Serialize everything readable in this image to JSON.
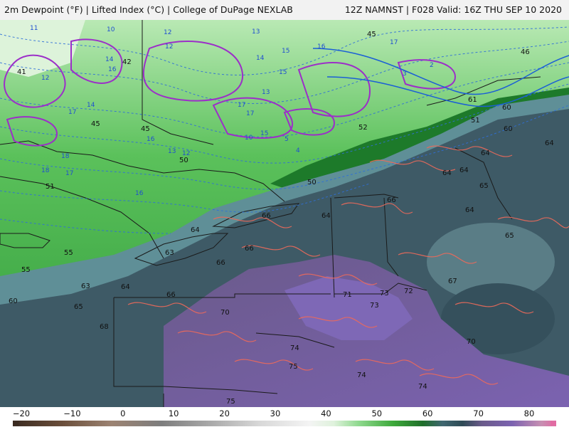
{
  "header": {
    "left_text": "2m Dewpoint (°F) | Lifted Index (°C) | College of DuPage NEXLAB",
    "right_text": "12Z NAMNST | F028 Valid: 16Z THU SEP 10 2020"
  },
  "colorbar": {
    "ticks": [
      "−20",
      "−10",
      "0",
      "10",
      "20",
      "30",
      "40",
      "50",
      "60",
      "70",
      "80"
    ],
    "min": -25,
    "max": 85,
    "stops": [
      {
        "v": -25,
        "c": "#3a2a20"
      },
      {
        "v": -15,
        "c": "#6a4e3a"
      },
      {
        "v": -5,
        "c": "#9c8372"
      },
      {
        "v": 5,
        "c": "#7d7d7d"
      },
      {
        "v": 15,
        "c": "#a9a9a9"
      },
      {
        "v": 25,
        "c": "#d8d8d8"
      },
      {
        "v": 35,
        "c": "#f4f4f4"
      },
      {
        "v": 40,
        "c": "#dff2dc"
      },
      {
        "v": 45,
        "c": "#8fd98e"
      },
      {
        "v": 52,
        "c": "#3da93a"
      },
      {
        "v": 58,
        "c": "#1f6e2a"
      },
      {
        "v": 62,
        "c": "#3f6670"
      },
      {
        "v": 66,
        "c": "#2e4a55"
      },
      {
        "v": 70,
        "c": "#6a5a8a"
      },
      {
        "v": 76,
        "c": "#7b62b0"
      },
      {
        "v": 82,
        "c": "#c78fb2"
      },
      {
        "v": 85,
        "c": "#e26aa2"
      }
    ]
  },
  "map_labels": {
    "dewpoint": [
      "41",
      "42",
      "45",
      "45",
      "45",
      "50",
      "51",
      "55",
      "55",
      "60",
      "63",
      "64",
      "63",
      "64",
      "65",
      "66",
      "66",
      "66",
      "66",
      "64",
      "64",
      "65",
      "64",
      "64",
      "68",
      "70",
      "71",
      "72",
      "73",
      "73",
      "74",
      "75",
      "75",
      "74",
      "74",
      "70",
      "67",
      "66",
      "60",
      "61",
      "64",
      "46",
      "52",
      "50",
      "51",
      "60",
      "65",
      "64"
    ],
    "lifted_index": [
      "11",
      "12",
      "10",
      "14",
      "16",
      "17",
      "17",
      "13",
      "12",
      "15",
      "16",
      "14",
      "18",
      "18",
      "17",
      "16",
      "17",
      "15",
      "13",
      "12",
      "10",
      "12",
      "16",
      "17",
      "15",
      "14",
      "13",
      "3",
      "2",
      "5",
      "4"
    ]
  }
}
